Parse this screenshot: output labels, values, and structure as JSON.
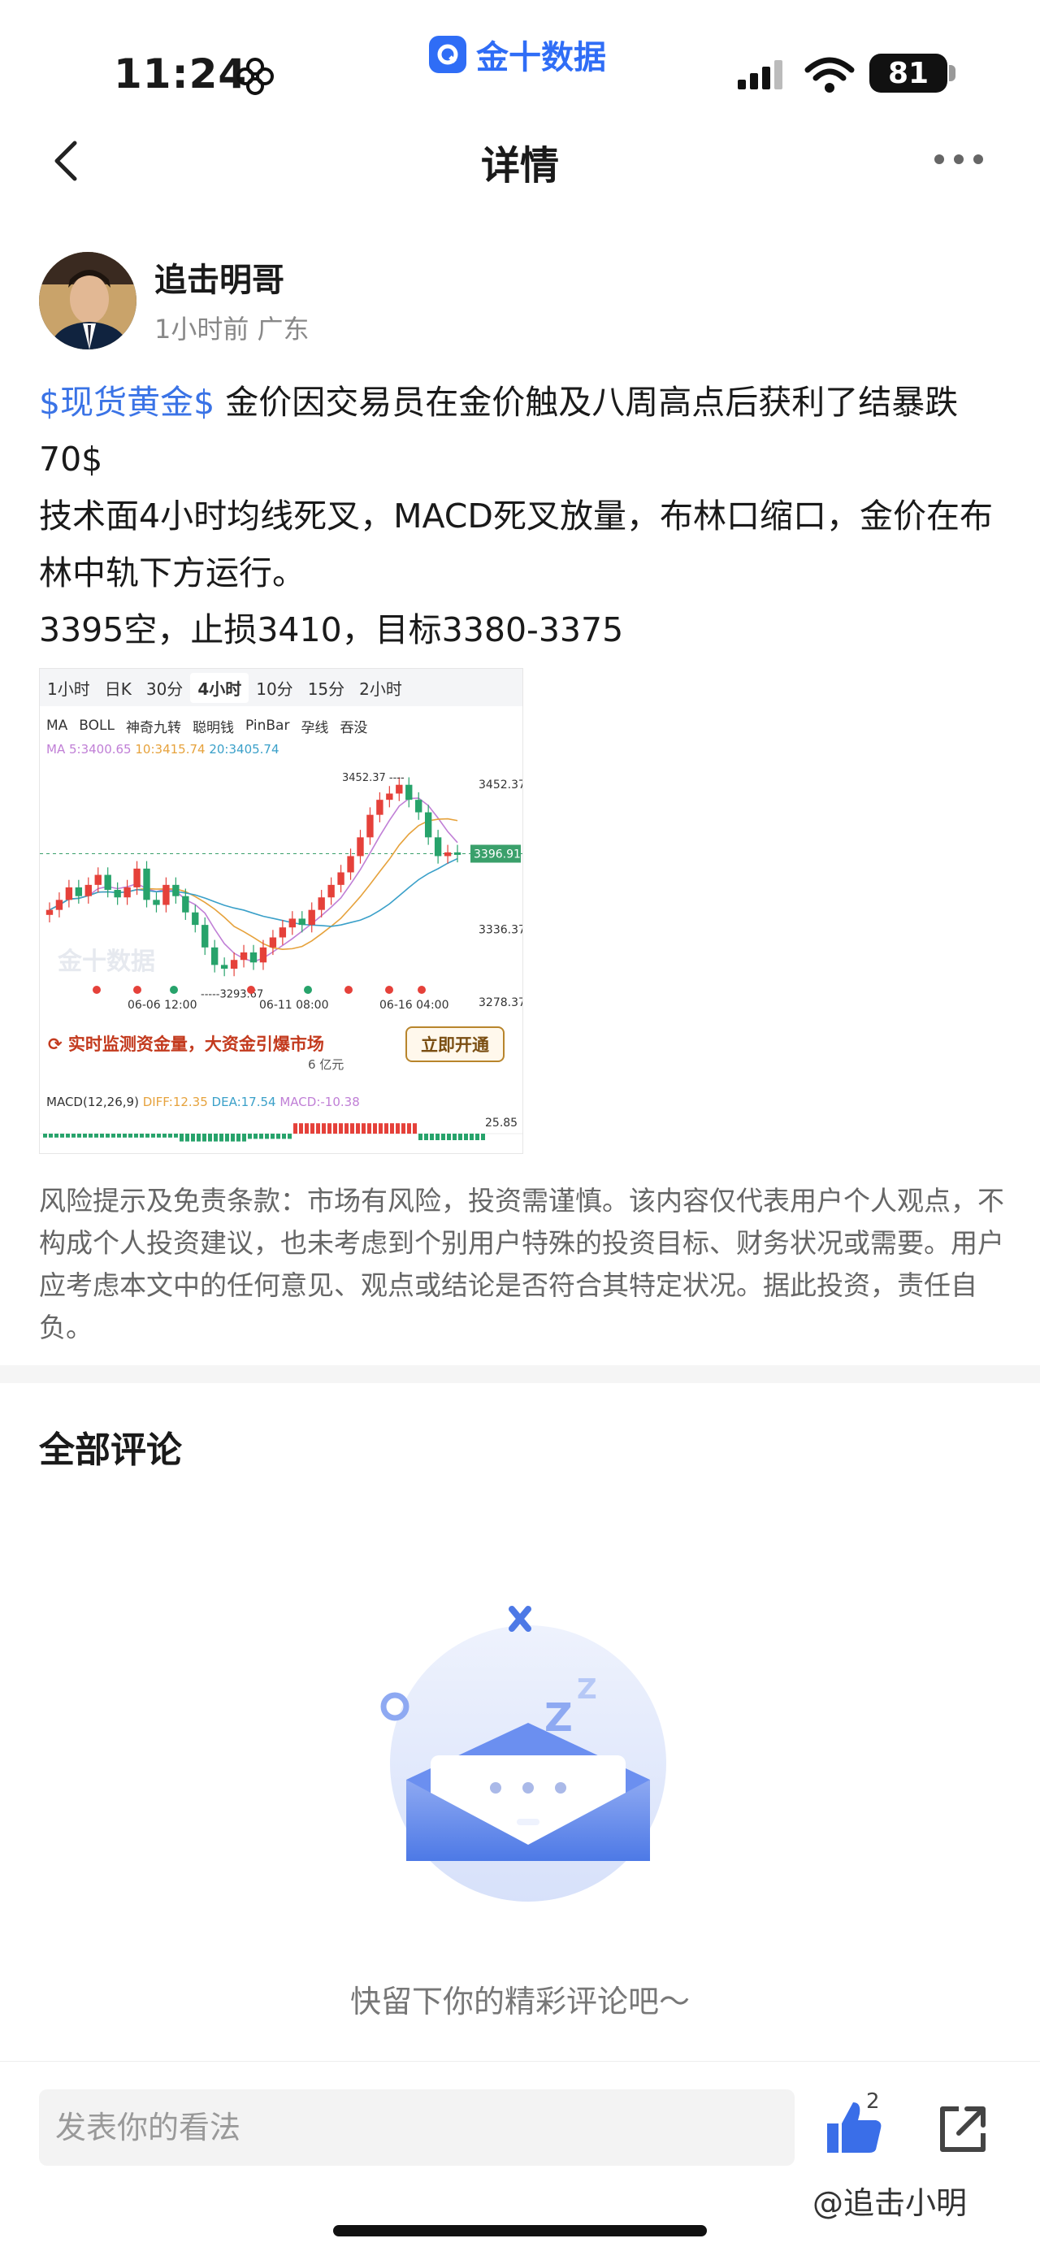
{
  "status_bar": {
    "time": "11:24",
    "app_name": "金十数据",
    "battery": "81"
  },
  "nav": {
    "title": "详情"
  },
  "author": {
    "name": "追击明哥",
    "meta": "1小时前 广东"
  },
  "post": {
    "tag": "$现货黄金$",
    "line1": " 金价因交易员在金价触及八周高点后获利了结暴跌70$",
    "line2": "技术面4小时均线死叉，MACD死叉放量，布林口缩口，金价在布林中轨下方运行。",
    "line3": "3395空，止损3410，目标3380-3375"
  },
  "chart": {
    "tabs": [
      "1小时",
      "日K",
      "30分",
      "4小时",
      "10分",
      "15分",
      "2小时"
    ],
    "active_tab": "4小时",
    "indicators": [
      "MA",
      "BOLL",
      "神奇九转",
      "聪明钱",
      "PinBar",
      "孕线",
      "吞没"
    ],
    "ma_legend": {
      "ma5": "MA 5:3400.65",
      "ma10": "10:3415.74",
      "ma20": "20:3405.74"
    },
    "y_ticks": [
      "3452.37",
      "3336.37",
      "3278.37"
    ],
    "current_price": "3396.91",
    "high_label": "3452.37",
    "low_label": "3293.67",
    "x_ticks": [
      "06-06 12:00",
      "06-11 08:00",
      "06-16 04:00"
    ],
    "watermark": "金十数据",
    "promo_text": "实时监测资金量，大资金引爆市场",
    "promo_sub": "6 亿元",
    "promo_button": "立即开通",
    "macd_legend": {
      "label": "MACD(12,26,9)",
      "diff": "DIFF:12.35",
      "dea": "DEA:17.54",
      "macd": "MACD:-10.38"
    },
    "macd_tick": "25.85",
    "colors": {
      "up": "#e5413a",
      "down": "#27a36b",
      "ma5": "#c07fd6",
      "ma10": "#e6a23c",
      "ma20": "#3aa0c9"
    },
    "chart_data": {
      "type": "candlestick",
      "title": "",
      "ylim": [
        3278.37,
        3470
      ],
      "close": [
        3352,
        3360,
        3370,
        3363,
        3372,
        3380,
        3368,
        3362,
        3370,
        3385,
        3360,
        3356,
        3372,
        3363,
        3350,
        3340,
        3322,
        3308,
        3305,
        3312,
        3318,
        3310,
        3322,
        3330,
        3338,
        3345,
        3340,
        3352,
        3362,
        3372,
        3382,
        3395,
        3410,
        3428,
        3440,
        3445,
        3452,
        3440,
        3430,
        3410,
        3395,
        3398,
        3396
      ]
    }
  },
  "disclaimer": "风险提示及免责条款：市场有风险，投资需谨慎。该内容仅代表用户个人观点，不构成个人投资建议，也未考虑到个别用户特殊的投资目标、财务状况或需要。用户应考虑本文中的任何意见、观点或结论是否符合其特定状况。据此投资，责任自负。",
  "comments": {
    "title": "全部评论",
    "empty_text": "快留下你的精彩评论吧～"
  },
  "bottom": {
    "input_placeholder": "发表你的看法",
    "like_count": "2",
    "watermark": "@追击小明"
  }
}
